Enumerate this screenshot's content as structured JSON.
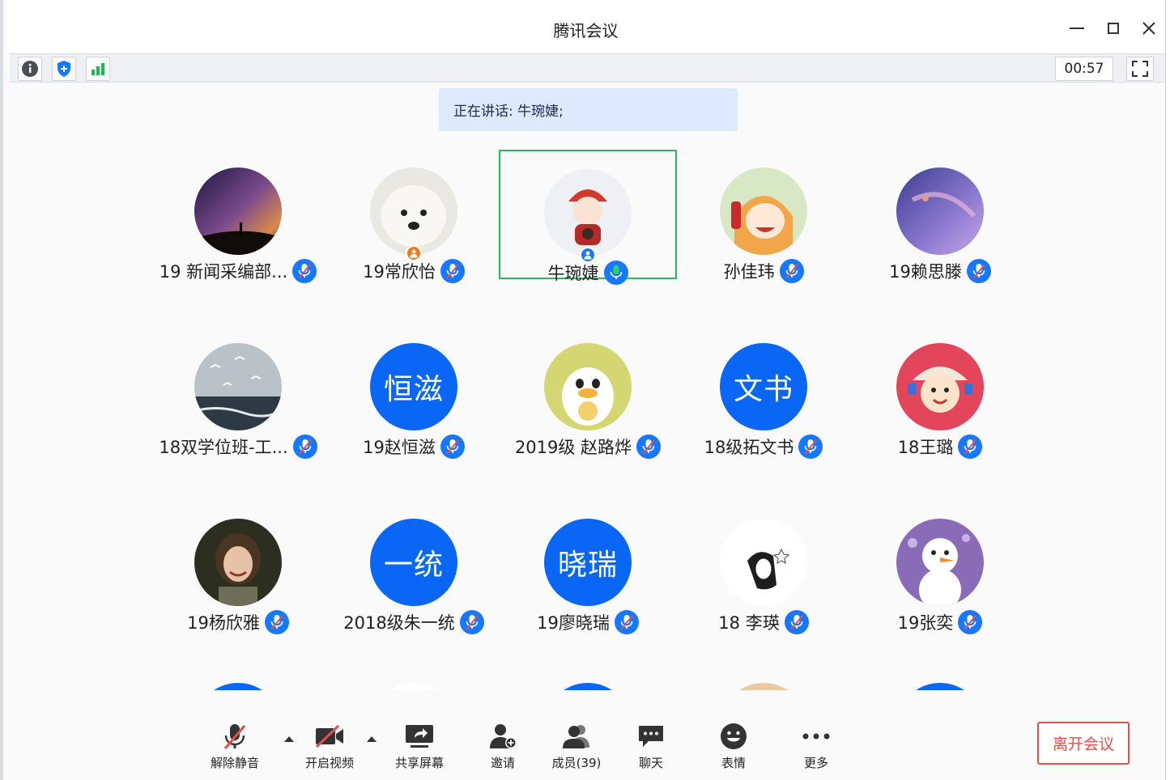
{
  "window": {
    "title": "腾讯会议"
  },
  "status": {
    "timer": "00:57"
  },
  "speaking_banner": "正在讲话: 牛琬婕;",
  "participants": [
    {
      "name": "19 新闻采编部...",
      "avatar": "photo-milky-way",
      "mic": "muted"
    },
    {
      "name": "19常欣怡",
      "avatar": "photo-white-dog",
      "mic": "muted",
      "host": true
    },
    {
      "name": "牛琬婕",
      "avatar": "cartoon-girl-tiger-hat",
      "mic": "speaking",
      "me": true
    },
    {
      "name": "孙佳玮",
      "avatar": "anime-umaru",
      "mic": "muted"
    },
    {
      "name": "19赖思滕",
      "avatar": "photo-purple-sky",
      "mic": "muted"
    },
    {
      "name": "18双学位班-工...",
      "avatar": "photo-seagulls",
      "mic": "muted"
    },
    {
      "name": "19赵恒滋",
      "avatar_text": "恒滋",
      "mic": "muted"
    },
    {
      "name": "2019级 赵路烨",
      "avatar": "cartoon-duck",
      "mic": "muted"
    },
    {
      "name": "18级拓文书",
      "avatar_text": "文书",
      "mic": "muted"
    },
    {
      "name": "18王璐",
      "avatar": "cartoon-peko",
      "mic": "muted"
    },
    {
      "name": "19杨欣雅",
      "avatar": "photo-girl",
      "mic": "muted"
    },
    {
      "name": "2018级朱一统",
      "avatar_text": "一统",
      "mic": "muted"
    },
    {
      "name": "19廖晓瑞",
      "avatar_text": "晓瑞",
      "mic": "muted"
    },
    {
      "name": "18 李瑛",
      "avatar": "anime-sketch-girl",
      "mic": "muted"
    },
    {
      "name": "19张奕",
      "avatar": "cartoon-olaf",
      "mic": "muted"
    }
  ],
  "toolbar": {
    "unmute": "解除静音",
    "video": "开启视频",
    "share": "共享屏幕",
    "invite": "邀请",
    "members": "成员(39)",
    "chat": "聊天",
    "emoji": "表情",
    "more": "更多",
    "leave": "离开会议"
  },
  "colors": {
    "accent": "#1677ff",
    "speaking_frame": "#1dbf5f",
    "leave": "#e0504a",
    "text_avatar": "#0a66f5"
  }
}
